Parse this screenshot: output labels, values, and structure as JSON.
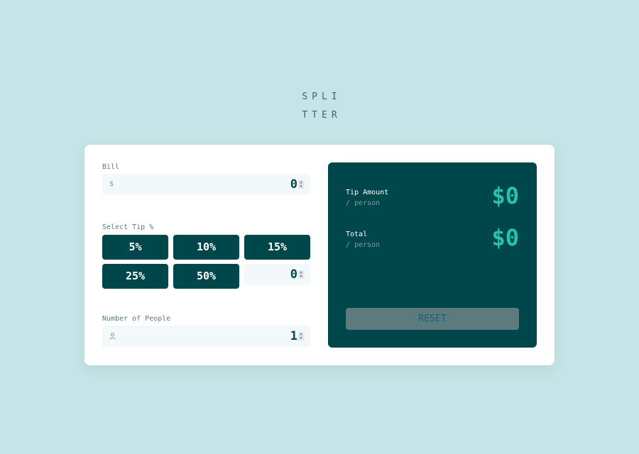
{
  "logo": {
    "line1": "SPLI",
    "line2": "TTER"
  },
  "bill": {
    "label": "Bill",
    "prefix_icon": "$",
    "value": "0"
  },
  "tip": {
    "label": "Select Tip %",
    "options": [
      "5%",
      "10%",
      "15%",
      "25%",
      "50%"
    ],
    "custom_value": "0"
  },
  "people": {
    "label": "Number of People",
    "icon": "person-icon",
    "value": "1"
  },
  "results": {
    "tip_amount_label": "Tip Amount",
    "tip_amount_sub": "/ person",
    "tip_amount_value": "$0",
    "total_label": "Total",
    "total_sub": "/ person",
    "total_value": "$0",
    "reset_label": "RESET"
  },
  "colors": {
    "background": "#c5e4e7",
    "dark_teal": "#00474b",
    "accent": "#26c2ae",
    "input_bg": "#f3f9fa",
    "reset_disabled": "#5e7a7d"
  }
}
